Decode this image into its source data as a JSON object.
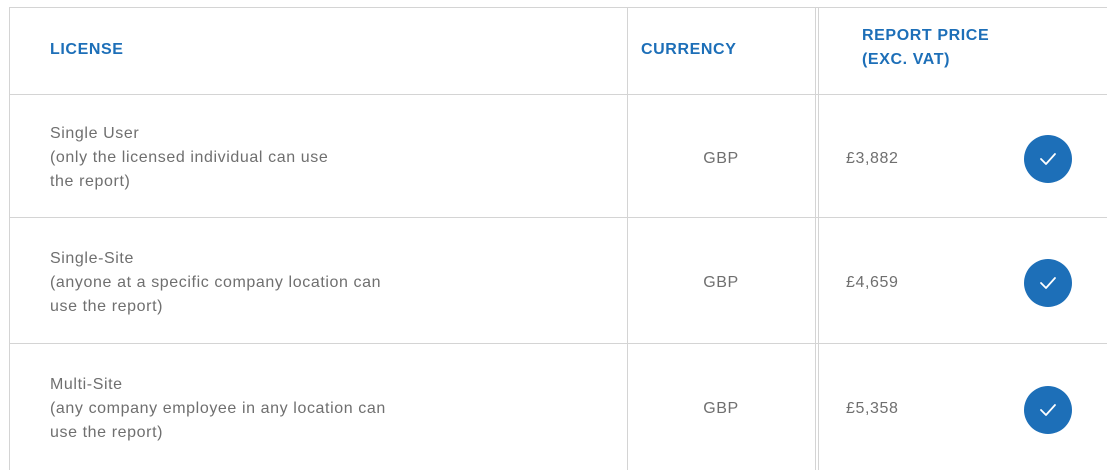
{
  "header": {
    "license": "LICENSE",
    "currency": "CURRENCY",
    "price_strong": "REPORT",
    "price_rest": " PRICE",
    "price_sub": "(EXC. VAT)"
  },
  "rows": [
    {
      "license_lines": [
        "Single User",
        "(only the licensed individual can use",
        "the report)"
      ],
      "currency": "GBP",
      "price": "£3,882",
      "selected": true
    },
    {
      "license_lines": [
        "Single-Site",
        "(anyone at a specific company location can",
        "use the report)"
      ],
      "currency": "GBP",
      "price": "£4,659",
      "selected": true
    },
    {
      "license_lines": [
        "Multi-Site",
        "(any company employee in any location can",
        "use the report)"
      ],
      "currency": "GBP",
      "price": "£5,358",
      "selected": true
    }
  ],
  "colors": {
    "accent": "#1d6fb8",
    "text": "#6f6f6f",
    "border": "#d4d4d4"
  },
  "icons": {
    "select": "checkmark-circle-icon"
  }
}
